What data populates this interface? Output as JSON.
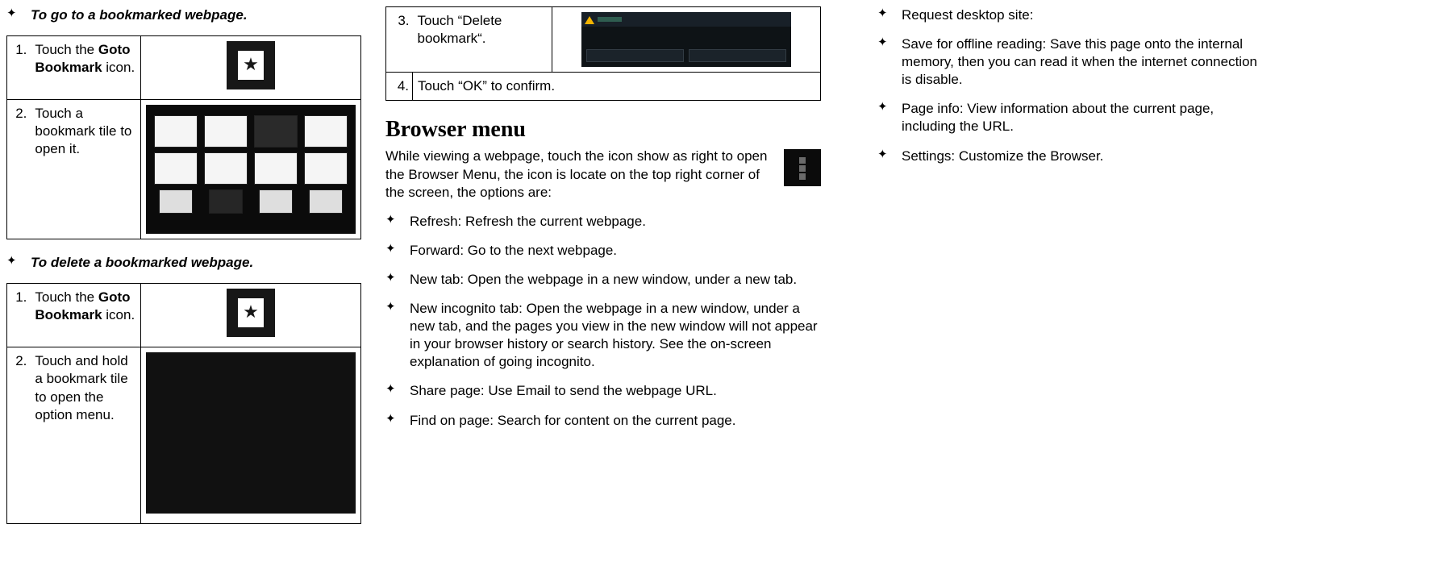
{
  "col1": {
    "heading_go": "To go to a bookmarked webpage.",
    "go_step1_number": "1.",
    "go_step1_a": "Touch the ",
    "go_step1_b": "Goto Bookmark",
    "go_step1_c": " icon.",
    "go_step2_number": "2.",
    "go_step2": "Touch a bookmark tile to open it.",
    "heading_delete": "To delete a bookmarked webpage.",
    "del_step1_number": "1.",
    "del_step1_a": "Touch the ",
    "del_step1_b": "Goto Bookmark",
    "del_step1_c": " icon.",
    "del_step2_number": "2.",
    "del_step2": "Touch and hold a bookmark tile to open the option menu."
  },
  "col2": {
    "step3_number": "3.",
    "step3": "Touch “Delete bookmark“.",
    "step4_number": "4.",
    "step4": "Touch “OK” to confirm.",
    "heading": "Browser menu",
    "intro": "While viewing a webpage, touch the icon show as right to open the Browser Menu, the icon is locate on the top right corner of the screen, the options are:",
    "items": [
      "Refresh: Refresh the current webpage.",
      "Forward: Go to the next webpage.",
      "New tab: Open the webpage in a new window, under a new tab.",
      "New incognito tab: Open the webpage in a new window, under a new tab, and the pages you view in the new window will not appear in your browser history or search history. See the on-screen explanation of going incognito.",
      "Share page: Use Email to send the webpage URL.",
      "Find on page: Search for content on the current page."
    ]
  },
  "col3": {
    "items": [
      "Request desktop site:",
      "Save for offline reading: Save this page onto the internal memory, then you can read it when the internet connection is disable.",
      "Page info: View information about the current page, including the URL.",
      "Settings: Customize the Browser."
    ]
  }
}
